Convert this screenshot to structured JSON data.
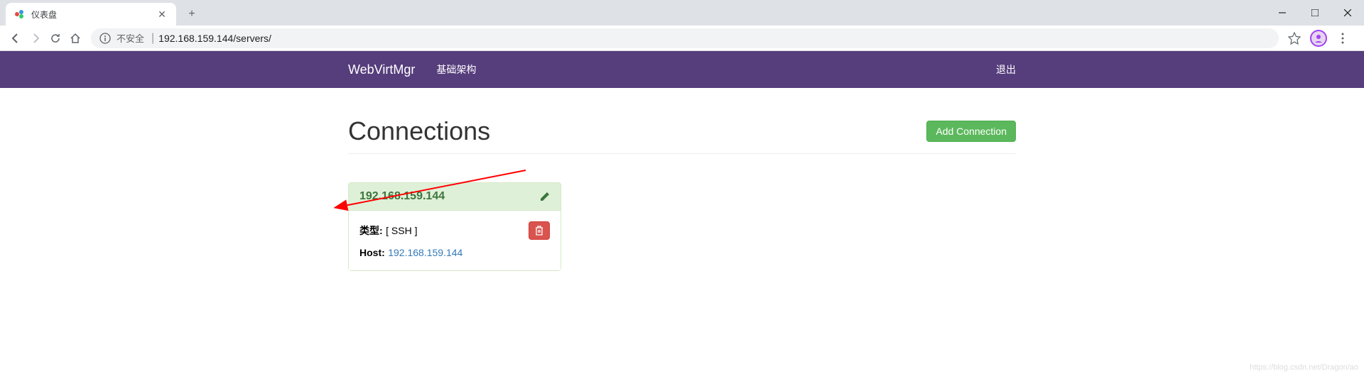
{
  "browser": {
    "tab_title": "仪表盘",
    "insecure_label": "不安全",
    "url": "192.168.159.144/servers/"
  },
  "navbar": {
    "brand": "WebVirtMgr",
    "infrastructure": "基础架构",
    "logout": "退出"
  },
  "page": {
    "title": "Connections",
    "add_button": "Add Connection"
  },
  "connection": {
    "name": "192.168.159.144",
    "type_label": "类型:",
    "type_value": "[ SSH ]",
    "host_label": "Host:",
    "host_value": "192.168.159.144"
  },
  "watermark": "https://blog.csdn.net/Dragon/ao"
}
